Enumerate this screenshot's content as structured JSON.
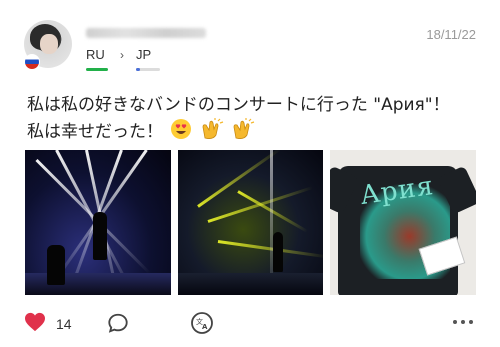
{
  "post": {
    "username": "username",
    "date": "18/11/22",
    "languages": {
      "native": "RU",
      "learning": "JP"
    },
    "text_line1": "私は私の好きなバンドのコンサートに行った \"Ария\"！",
    "text_line2": "私は幸せだった！",
    "logo_text": "Ария",
    "likes": "14",
    "flag": "russia-flag"
  },
  "colors": {
    "like": "#e0314b",
    "native_bar": "#22b04a",
    "learning_bar": "#4a6fd8",
    "date": "#9a9a9a"
  },
  "icons": {
    "like": "heart-icon",
    "comment": "comment-bubble-icon",
    "translate": "translate-icon",
    "more": "more-dots-icon",
    "separator": "chevron-right-icon"
  }
}
